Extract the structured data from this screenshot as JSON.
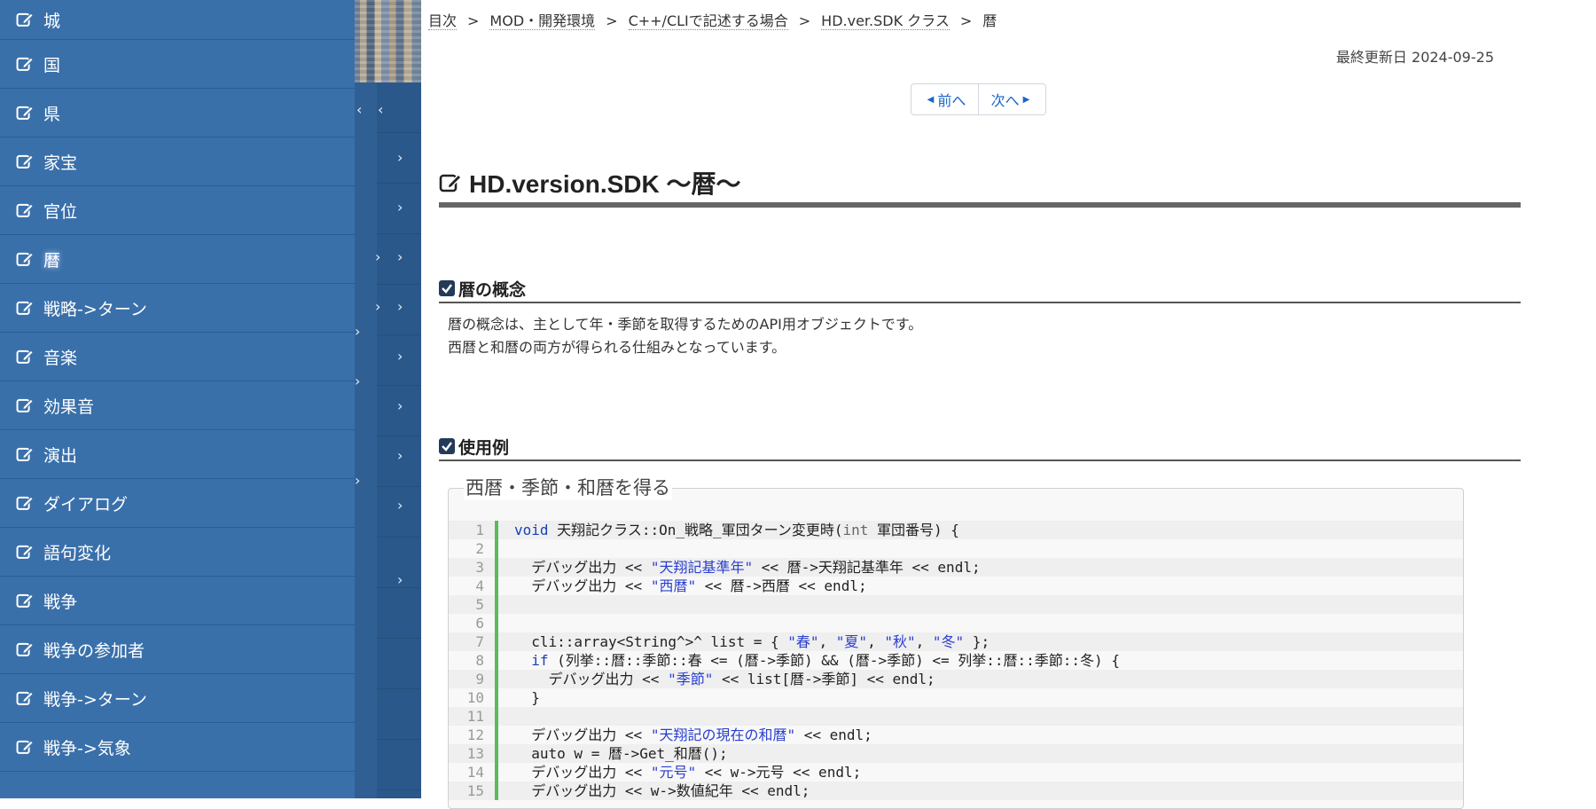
{
  "sidebar": {
    "items": [
      {
        "label": "城",
        "active": false
      },
      {
        "label": "国",
        "active": false
      },
      {
        "label": "県",
        "active": false
      },
      {
        "label": "家宝",
        "active": false
      },
      {
        "label": "官位",
        "active": false
      },
      {
        "label": "暦",
        "active": true
      },
      {
        "label": "戦略->ターン",
        "active": false
      },
      {
        "label": "音楽",
        "active": false
      },
      {
        "label": "効果音",
        "active": false
      },
      {
        "label": "演出",
        "active": false
      },
      {
        "label": "ダイアログ",
        "active": false
      },
      {
        "label": "語句変化",
        "active": false
      },
      {
        "label": "戦争",
        "active": false
      },
      {
        "label": "戦争の参加者",
        "active": false
      },
      {
        "label": "戦争->ターン",
        "active": false
      },
      {
        "label": "戦争->気象",
        "active": false
      }
    ]
  },
  "breadcrumb": {
    "items": [
      "目次",
      "MOD・開発環境",
      "C++/CLIで記述する場合",
      "HD.ver.SDK クラス",
      "暦"
    ],
    "separator": ">"
  },
  "updated": "最終更新日 2024-09-25",
  "pager": {
    "prev": "前へ",
    "next": "次へ"
  },
  "title": "HD.version.SDK ～暦～",
  "sections": {
    "concept": {
      "heading": "暦の概念",
      "lines": [
        "暦の概念は、主として年・季節を取得するためのAPI用オブジェクトです。",
        "西暦と和暦の両方が得られる仕組みとなっています。"
      ]
    },
    "example": {
      "heading": "使用例",
      "legend": "西暦・季節・和暦を得る"
    }
  },
  "code": {
    "lines": [
      {
        "n": "1",
        "tokens": [
          {
            "t": "void",
            "c": "kw"
          },
          {
            "t": " 天翔記クラス::On_戦略_軍団ターン変更時(",
            "c": ""
          },
          {
            "t": "int",
            "c": "ty"
          },
          {
            "t": " 軍団番号) {",
            "c": ""
          }
        ]
      },
      {
        "n": "2",
        "tokens": []
      },
      {
        "n": "3",
        "tokens": [
          {
            "t": "  デバッグ出力 << ",
            "c": ""
          },
          {
            "t": "\"天翔記基準年\"",
            "c": "st"
          },
          {
            "t": " << 暦->天翔記基準年 << endl;",
            "c": ""
          }
        ]
      },
      {
        "n": "4",
        "tokens": [
          {
            "t": "  デバッグ出力 << ",
            "c": ""
          },
          {
            "t": "\"西暦\"",
            "c": "st"
          },
          {
            "t": " << 暦->西暦 << endl;",
            "c": ""
          }
        ]
      },
      {
        "n": "5",
        "tokens": []
      },
      {
        "n": "6",
        "tokens": []
      },
      {
        "n": "7",
        "tokens": [
          {
            "t": "  cli::array<String^>^ list = { ",
            "c": ""
          },
          {
            "t": "\"春\"",
            "c": "st"
          },
          {
            "t": ", ",
            "c": ""
          },
          {
            "t": "\"夏\"",
            "c": "st"
          },
          {
            "t": ", ",
            "c": ""
          },
          {
            "t": "\"秋\"",
            "c": "st"
          },
          {
            "t": ", ",
            "c": ""
          },
          {
            "t": "\"冬\"",
            "c": "st"
          },
          {
            "t": " };",
            "c": ""
          }
        ]
      },
      {
        "n": "8",
        "tokens": [
          {
            "t": "  ",
            "c": ""
          },
          {
            "t": "if",
            "c": "kw"
          },
          {
            "t": " (列挙::暦::季節::春 <= (暦->季節) && (暦->季節) <= 列挙::暦::季節::冬) {",
            "c": ""
          }
        ]
      },
      {
        "n": "9",
        "tokens": [
          {
            "t": "    デバッグ出力 << ",
            "c": ""
          },
          {
            "t": "\"季節\"",
            "c": "st"
          },
          {
            "t": " << list[暦->季節] << endl;",
            "c": ""
          }
        ]
      },
      {
        "n": "10",
        "tokens": [
          {
            "t": "  }",
            "c": ""
          }
        ]
      },
      {
        "n": "11",
        "tokens": []
      },
      {
        "n": "12",
        "tokens": [
          {
            "t": "  デバッグ出力 << ",
            "c": ""
          },
          {
            "t": "\"天翔記の現在の和暦\"",
            "c": "st"
          },
          {
            "t": " << endl;",
            "c": ""
          }
        ]
      },
      {
        "n": "13",
        "tokens": [
          {
            "t": "  auto w = 暦->Get_和暦();",
            "c": ""
          }
        ]
      },
      {
        "n": "14",
        "tokens": [
          {
            "t": "  デバッグ出力 << ",
            "c": ""
          },
          {
            "t": "\"元号\"",
            "c": "st"
          },
          {
            "t": " << w->元号 << endl;",
            "c": ""
          }
        ]
      },
      {
        "n": "15",
        "tokens": [
          {
            "t": "  デバッグ出力 << w->数値紀年 << endl;",
            "c": ""
          }
        ]
      }
    ]
  },
  "colors": {
    "sidebar_bg": "#3a70aa",
    "accent_link": "#1a67c9",
    "code_bar": "#5bbb5b",
    "string": "#2a3fd0",
    "keyword": "#1a3fb3"
  },
  "icons": {
    "sidebar_item": "edit-icon",
    "title": "edit-icon",
    "section": "checkbox-checked-icon",
    "nav": "chevron-right-icon",
    "collapse": "chevron-left-icon"
  }
}
